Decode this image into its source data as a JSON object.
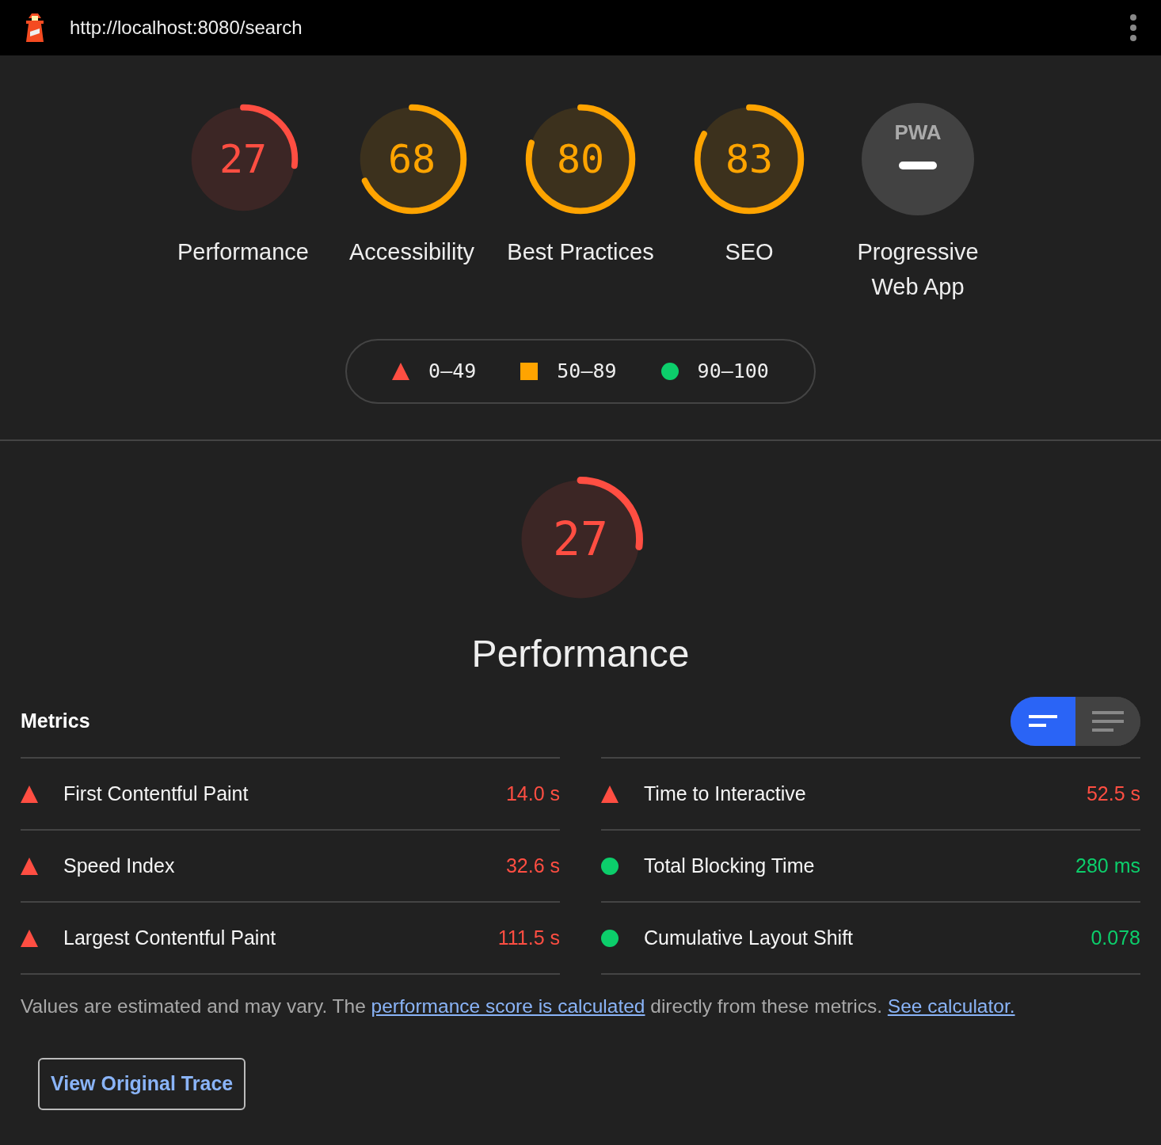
{
  "top_bar": {
    "url": "http://localhost:8080/search"
  },
  "gauges": [
    {
      "kind": "score",
      "color": "#ff4e42",
      "score": "27",
      "level": 0.27,
      "label": "Performance"
    },
    {
      "kind": "score",
      "color": "#ffa400",
      "score": "68",
      "level": 0.68,
      "label": "Accessibility"
    },
    {
      "kind": "score",
      "color": "#ffa400",
      "score": "80",
      "level": 0.8,
      "label": "Best Practices"
    },
    {
      "kind": "score",
      "color": "#ffa400",
      "score": "83",
      "level": 0.83,
      "label": "SEO"
    },
    {
      "kind": "pwa",
      "badge": "PWA",
      "label": "Progressive Web App"
    }
  ],
  "legend": [
    {
      "kind": "triangle",
      "color": "#ff4e42",
      "range": "0–49"
    },
    {
      "kind": "square",
      "color": "#ffa400",
      "range": "50–89"
    },
    {
      "kind": "circle",
      "color": "#0cce6b",
      "range": "90–100"
    }
  ],
  "category": {
    "color": "#ff4e42",
    "score": "27",
    "level": 0.27,
    "title": "Performance"
  },
  "metrics_heading": "Metrics",
  "view_toggle": [
    {
      "kind": "compact",
      "selected": true
    },
    {
      "kind": "expanded",
      "selected": false
    }
  ],
  "metrics": [
    {
      "name": "First Contentful Paint",
      "value": "14.0 s",
      "kind": "triangle",
      "color": "#ff4e42"
    },
    {
      "name": "Time to Interactive",
      "value": "52.5 s",
      "kind": "triangle",
      "color": "#ff4e42"
    },
    {
      "name": "Speed Index",
      "value": "32.6 s",
      "kind": "triangle",
      "color": "#ff4e42"
    },
    {
      "name": "Total Blocking Time",
      "value": "280 ms",
      "kind": "circle",
      "color": "#0cce6b"
    },
    {
      "name": "Largest Contentful Paint",
      "value": "111.5 s",
      "kind": "triangle",
      "color": "#ff4e42"
    },
    {
      "name": "Cumulative Layout Shift",
      "value": "0.078",
      "kind": "circle",
      "color": "#0cce6b"
    }
  ],
  "footnote": {
    "before": "Values are estimated and may vary. The",
    "link1": "performance score is calculated",
    "middle": "directly from these metrics.",
    "link2": "See calculator."
  },
  "trace_button": "View Original Trace"
}
